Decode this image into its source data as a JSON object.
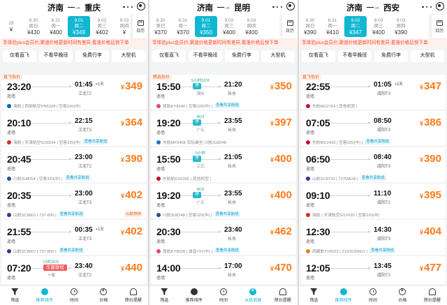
{
  "panels": [
    {
      "from": "济南",
      "to": "重庆",
      "dates": [
        {
          "d": "29",
          "w": "",
          "p": "¥"
        },
        {
          "d": "8.30",
          "w": "周日",
          "p": "¥430"
        },
        {
          "d": "8.31",
          "w": "周一",
          "p": "¥400"
        },
        {
          "d": "9.01",
          "w": "周二",
          "p": "¥349",
          "sel": true
        },
        {
          "d": "9.02",
          "w": "周三",
          "p": "¥402"
        },
        {
          "d": "9.03",
          "w": "周四",
          "p": "¥"
        }
      ],
      "notice": "享体验plus会员价,渠道价格更新时间有差异,看准价格后快下单",
      "filters": [
        "仅看直飞",
        "不看早晚班",
        "免费行李",
        "大型机"
      ],
      "flights": [
        {
          "tag": "直飞低价",
          "dep": "23:20",
          "arr": "01:45",
          "plus": "+1天",
          "depAirport": "遥墙",
          "arrAirport": "江北T2",
          "price": "349",
          "logo": "#0066b3",
          "meta": "海航 | 西部航空PN6328 | 空客320(中)",
          "share": "",
          "stopTop": "",
          "stopBox": "",
          "stopCity": "",
          "express": ""
        },
        {
          "tag": "",
          "dep": "20:10",
          "arr": "22:15",
          "plus": "",
          "depAirport": "遥墙",
          "arrAirport": "江北T3",
          "price": "364",
          "logo": "#d62b2b",
          "meta": "海航 | 天津航空GS6594 | 空客320(中)",
          "share": "查看共享航班",
          "stopTop": "",
          "stopBox": "",
          "stopCity": "",
          "express": ""
        },
        {
          "tag": "",
          "dep": "20:45",
          "arr": "23:00",
          "plus": "",
          "depAirport": "遥墙",
          "arrAirport": "江北T2",
          "price": "390",
          "logo": "#2b4a9e",
          "meta": "川航3U8054 | 空客320(中) | ",
          "share": "查看共享航班",
          "stopTop": "",
          "stopBox": "",
          "stopCity": "",
          "express": ""
        },
        {
          "tag": "",
          "dep": "20:35",
          "arr": "23:00",
          "plus": "",
          "depAirport": "遥墙",
          "arrAirport": "江北T3",
          "price": "402",
          "logo": "#333399",
          "meta": "山航SC8801 | 737-800 |",
          "share": "查看共享航班",
          "stopTop": "",
          "stopBox": "",
          "stopCity": "",
          "express": "山航快线"
        },
        {
          "tag": "",
          "dep": "21:55",
          "arr": "00:35",
          "plus": "+1天",
          "depAirport": "遥墙",
          "arrAirport": "江北T3",
          "price": "402",
          "logo": "#333399",
          "meta": "山航SC8807 | 737-800 |",
          "share": "查看共享航班",
          "stopTop": "",
          "stopBox": "",
          "stopCity": "",
          "express": ""
        },
        {
          "tag": "",
          "dep": "07:20",
          "arr": "23:40",
          "plus": "",
          "depAirport": "遥墙",
          "arrAirport": "江北T2",
          "price": "440",
          "logo": "#0066b3",
          "meta": "",
          "share": "",
          "stopTop": "13时20分",
          "stopBox": "华夏联程",
          "stopCity": "十堰",
          "express": ""
        }
      ],
      "nav": [
        "筛选",
        "推荐排序",
        "时间",
        "价格",
        "降价提醒"
      ],
      "active": 1
    },
    {
      "from": "济南",
      "to": "昆明",
      "dates": [
        {
          "d": "8.30",
          "w": "周日",
          "p": "¥370"
        },
        {
          "d": "8.31",
          "w": "周一",
          "p": "¥370"
        },
        {
          "d": "9.01",
          "w": "周二",
          "p": "¥350",
          "sel": true
        },
        {
          "d": "9.02",
          "w": "周三",
          "p": "¥400"
        },
        {
          "d": "9.03",
          "w": "周四",
          "p": "¥400"
        }
      ],
      "notice": "享体验plus会员价,渠道价格更新时间有差异,看准价格后快下单",
      "filters": [
        "仅看直飞",
        "不看早晚班",
        "免费行李",
        "大型机"
      ],
      "flights": [
        {
          "tag": "精选低价",
          "dep": "15:50",
          "arr": "21:20",
          "plus": "",
          "depAirport": "遥墙",
          "arrAirport": "长水",
          "price": "350",
          "logo": "#e0457b",
          "meta": "昆航KY8240 | 空客320(中) |",
          "share": "查看共享航班",
          "stopTop": "5小时10分",
          "stopBox": "停",
          "stopCity": "湘州",
          "express": ""
        },
        {
          "tag": "",
          "dep": "19:20",
          "arr": "23:55",
          "plus": "",
          "depAirport": "遥墙",
          "arrAirport": "长水",
          "price": "397",
          "logo": "#1a73c9",
          "meta": "东航MF5468 实际乘坐 川航3U8248",
          "share": "",
          "stopTop": "45分",
          "stopBox": "停",
          "stopCity": "广元",
          "express": ""
        },
        {
          "tag": "",
          "dep": "15:50",
          "arr": "21:05",
          "plus": "",
          "depAirport": "遥墙",
          "arrAirport": "长水",
          "price": "400",
          "logo": "#c8102e",
          "meta": "东航航DZ6366 | 其他机型 |",
          "share": "",
          "stopTop": "5小时",
          "stopBox": "停",
          "stopCity": "江北",
          "express": ""
        },
        {
          "tag": "",
          "dep": "19:20",
          "arr": "23:55",
          "plus": "",
          "depAirport": "遥墙",
          "arrAirport": "长水",
          "price": "400",
          "logo": "#2b4a9e",
          "meta": "川航3U8248 | 空客320(中) |",
          "share": "查看共享航班",
          "stopTop": "45分",
          "stopBox": "停",
          "stopCity": "广元",
          "express": ""
        },
        {
          "tag": "",
          "dep": "20:30",
          "arr": "23:40",
          "plus": "",
          "depAirport": "遥墙",
          "arrAirport": "长水",
          "price": "462",
          "logo": "#e0457b",
          "meta": "昆航KY8028 | 波音737(中) |",
          "share": "查看共享航班",
          "stopTop": "",
          "stopBox": "",
          "stopCity": "",
          "express": ""
        },
        {
          "tag": "",
          "dep": "14:00",
          "arr": "17:00",
          "plus": "",
          "depAirport": "遥墙",
          "arrAirport": "长水",
          "price": "470",
          "logo": "#333399",
          "meta": "",
          "share": "",
          "stopTop": "",
          "stopBox": "",
          "stopCity": "",
          "express": ""
        }
      ],
      "nav": [
        "筛选",
        "推荐排序",
        "时间",
        "从低到高",
        "降价提醒"
      ],
      "active": 3
    },
    {
      "from": "济南",
      "to": "西安",
      "dates": [
        {
          "d": "8.30",
          "w": "周日",
          "p": "¥390"
        },
        {
          "d": "8.31",
          "w": "周一",
          "p": "¥410"
        },
        {
          "d": "9.02",
          "w": "周二",
          "p": "¥347",
          "sel": true
        },
        {
          "d": "9.03",
          "w": "周三",
          "p": "¥400"
        },
        {
          "d": "9.03",
          "w": "周四",
          "p": "¥390"
        }
      ],
      "notice": "享体验plus会员价,渠道价格更新时间有差异,看准价格后快下单",
      "filters": [
        "仅看直飞",
        "不看早晚班",
        "免费行李",
        "大型机"
      ],
      "flights": [
        {
          "tag": "直飞低价",
          "dep": "22:55",
          "arr": "01:05",
          "plus": "+1天",
          "depAirport": "遥墙",
          "arrAirport": "咸阳T3",
          "price": "347",
          "logo": "#c8102e",
          "meta": "东航MU2764 | 其他机型 |",
          "share": "",
          "stopTop": "",
          "stopBox": "",
          "stopCity": "",
          "express": ""
        },
        {
          "tag": "",
          "dep": "07:05",
          "arr": "08:50",
          "plus": "",
          "depAirport": "遥墙",
          "arrAirport": "咸阳T3",
          "price": "386",
          "logo": "#c8102e",
          "meta": "东航MU2429 | 空客320(中) |",
          "share": "查看共享航班",
          "stopTop": "",
          "stopBox": "",
          "stopCity": "",
          "express": ""
        },
        {
          "tag": "",
          "dep": "06:50",
          "arr": "08:40",
          "plus": "",
          "depAirport": "遥墙",
          "arrAirport": "咸阳T3",
          "price": "390",
          "logo": "#333399",
          "meta": "山航SC8733 | 737MAX8 |",
          "share": "查看共享航班",
          "stopTop": "",
          "stopBox": "",
          "stopCity": "",
          "express": ""
        },
        {
          "tag": "",
          "dep": "09:10",
          "arr": "11:10",
          "plus": "",
          "depAirport": "遥墙",
          "arrAirport": "咸阳T2",
          "price": "395",
          "logo": "#d62b2b",
          "meta": "海航 | 天津航空GS7620 | 空客320(中)",
          "share": "",
          "stopTop": "",
          "stopBox": "",
          "stopCity": "",
          "express": ""
        },
        {
          "tag": "",
          "dep": "12:30",
          "arr": "14:30",
          "plus": "",
          "depAirport": "遥墙",
          "arrAirport": "咸阳T3",
          "price": "404",
          "logo": "#e67e22",
          "meta": "西藏航TV6022 | 319/319NEO |",
          "share": "查看共享航班",
          "stopTop": "",
          "stopBox": "",
          "stopCity": "",
          "express": ""
        },
        {
          "tag": "",
          "dep": "12:05",
          "arr": "13:45",
          "plus": "",
          "depAirport": "遥墙",
          "arrAirport": "咸阳T2",
          "price": "477",
          "logo": "#0066b3",
          "meta": "",
          "share": "",
          "stopTop": "",
          "stopBox": "",
          "stopCity": "",
          "express": ""
        }
      ],
      "nav": [
        "筛选",
        "推荐排序",
        "时间",
        "价格",
        "降价提醒"
      ],
      "active": 1
    }
  ],
  "calendar_label": "日历",
  "arrow": "—→",
  "currency": "¥"
}
